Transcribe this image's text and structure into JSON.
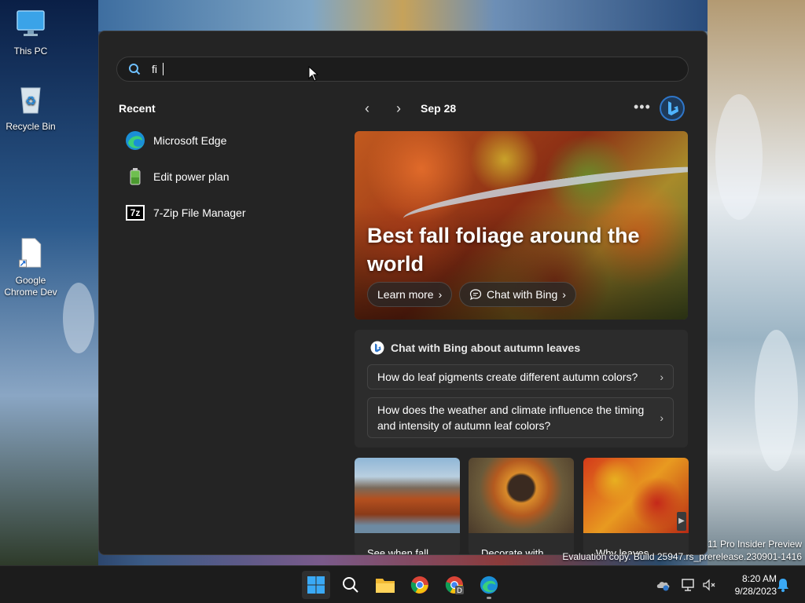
{
  "desktop": {
    "icons": [
      {
        "label": "This PC"
      },
      {
        "label": "Recycle Bin"
      },
      {
        "label": "Google Chrome Dev"
      }
    ]
  },
  "search": {
    "value": "fi"
  },
  "recent": {
    "title": "Recent",
    "items": [
      {
        "label": "Microsoft Edge",
        "icon": "edge-icon"
      },
      {
        "label": "Edit power plan",
        "icon": "power-plan-icon"
      },
      {
        "label": "7-Zip File Manager",
        "icon": "7zip-icon",
        "badge": "7z"
      }
    ]
  },
  "widget": {
    "date": "Sep 28",
    "hero_title": "Best fall foliage around the world",
    "learn_more": "Learn more",
    "chat_with_bing": "Chat with Bing",
    "chat_card_title": "Chat with Bing about autumn leaves",
    "questions": [
      "How do leaf pigments create different autumn colors?",
      "How does the weather and climate influence the timing and intensity of autumn leaf colors?"
    ],
    "thumbnails": [
      {
        "label": "See when fall"
      },
      {
        "label": "Decorate with"
      },
      {
        "label": "Why leaves"
      }
    ]
  },
  "watermark": {
    "line1": "11 Pro Insider Preview",
    "line2": "Evaluation copy. Build 25947.rs_prerelease.230901-1416"
  },
  "clock": {
    "time": "8:20 AM",
    "date": "9/28/2023"
  },
  "colors": {
    "accent": "#2f76c9",
    "panel": "#242424",
    "taskbar": "#1c1c1c"
  }
}
